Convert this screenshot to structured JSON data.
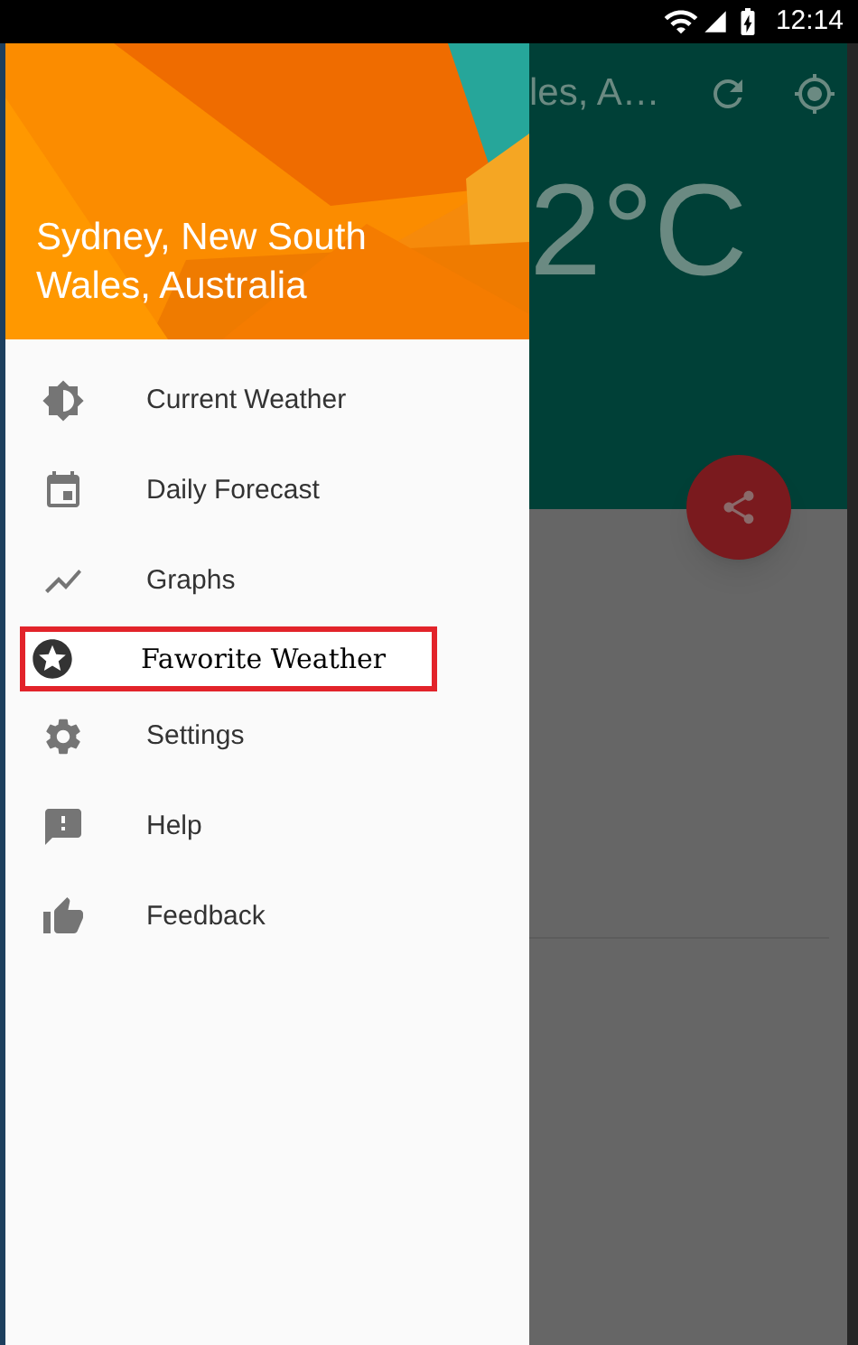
{
  "status_bar": {
    "time": "12:14"
  },
  "drawer": {
    "header": {
      "location": "Sydney, New South Wales, Australia"
    },
    "items": [
      {
        "label": "Current Weather",
        "kind": "normal"
      },
      {
        "label": "Daily Forecast",
        "kind": "normal"
      },
      {
        "label": "Graphs",
        "kind": "normal"
      },
      {
        "label": "Faworite Weather",
        "kind": "boxed"
      },
      {
        "label": "Settings",
        "kind": "normal"
      },
      {
        "label": "Help",
        "kind": "normal"
      },
      {
        "label": "Feedback",
        "kind": "normal"
      }
    ]
  },
  "main": {
    "title": "les, A…",
    "temperature": "2°C"
  }
}
